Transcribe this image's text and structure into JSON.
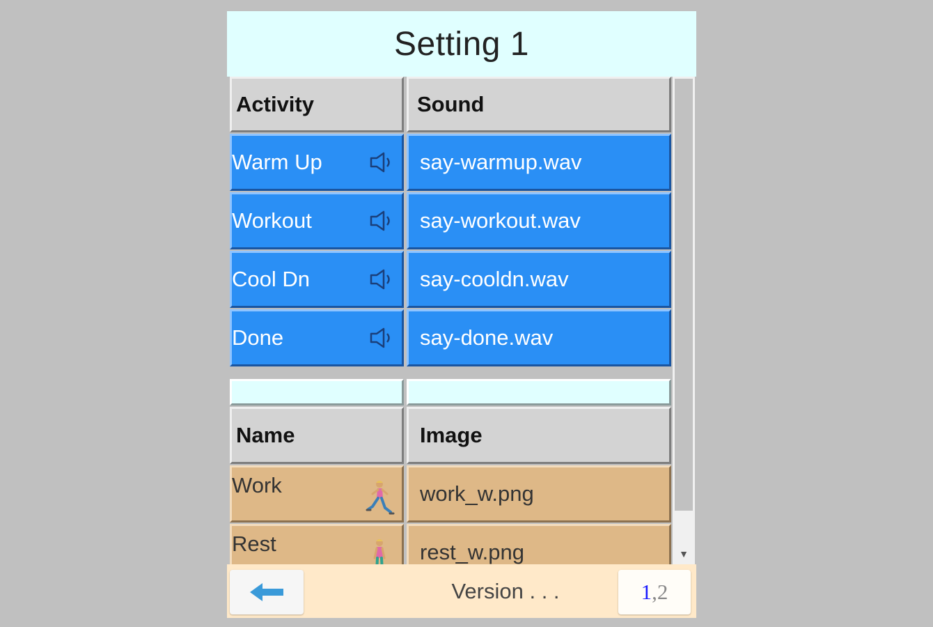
{
  "title": "Setting 1",
  "sound_table": {
    "headers": {
      "activity": "Activity",
      "sound": "Sound"
    },
    "rows": [
      {
        "activity": "Warm Up",
        "sound": "say-warmup.wav"
      },
      {
        "activity": "Workout",
        "sound": "say-workout.wav"
      },
      {
        "activity": "Cool Dn",
        "sound": "say-cooldn.wav"
      },
      {
        "activity": "Done",
        "sound": "say-done.wav"
      }
    ]
  },
  "image_table": {
    "headers": {
      "name": "Name",
      "image": "Image"
    },
    "rows": [
      {
        "name": "Work",
        "image": "work_w.png"
      },
      {
        "name": "Rest",
        "image": "rest_w.png"
      }
    ]
  },
  "footer": {
    "version_text": "Version . . .",
    "page_current": "1",
    "page_separator": ",",
    "page_other": "2"
  },
  "colors": {
    "title_bg": "#e0ffff",
    "header_bg": "#d3d3d3",
    "sound_row_bg": "#2a8ff5",
    "spacer_bg": "#e0ffff",
    "image_row_bg": "#deb887",
    "footer_bg": "#ffe9c9",
    "back_arrow": "#3a9ad9"
  },
  "icons": {
    "sound_row_icon": "speaker-icon",
    "work_image_icon": "running-woman-icon",
    "rest_image_icon": "standing-woman-icon",
    "back_icon": "left-arrow-icon"
  }
}
